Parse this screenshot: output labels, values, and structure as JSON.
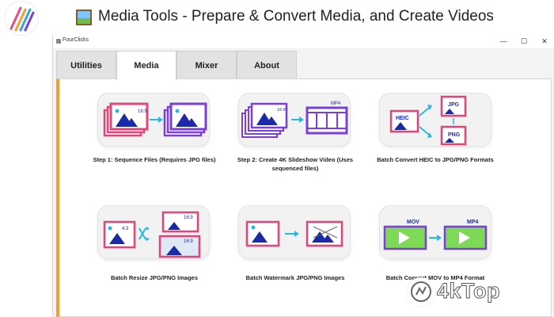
{
  "banner": {
    "title": "Media Tools - Prepare & Convert Media, and Create Videos"
  },
  "window": {
    "title": "FourClicks",
    "controls": [
      "—",
      "☐",
      "✕"
    ]
  },
  "tabs": [
    {
      "label": "Utilities",
      "active": false
    },
    {
      "label": "Media",
      "active": true
    },
    {
      "label": "Mixer",
      "active": false
    },
    {
      "label": "About",
      "active": false
    }
  ],
  "cards": [
    {
      "label": "Step 1: Sequence Files (Requires JPG files)",
      "icon": "sequence-files-icon"
    },
    {
      "label": "Step 2: Create 4K Slideshow Video (Uses sequenced files)",
      "icon": "slideshow-video-icon",
      "badge": "MP4"
    },
    {
      "label": "Batch Convert HEIC to JPG/PNG Formats",
      "icon": "heic-convert-icon",
      "badges": [
        "HEIC",
        "JPG",
        "PNG"
      ]
    },
    {
      "label": "Batch Resize JPG/PNG Images",
      "icon": "resize-icon",
      "badges": [
        "4:3",
        "16:9",
        "16:9"
      ]
    },
    {
      "label": "Batch Watermark JPG/PNG Images",
      "icon": "watermark-icon"
    },
    {
      "label": "Batch Convert MOV to MP4 Format",
      "icon": "mov-to-mp4-icon",
      "badges": [
        "MOV",
        "MP4"
      ]
    }
  ],
  "ratio_label": "16:9",
  "watermark": {
    "text": "4kTop"
  },
  "colors": {
    "accent": "#f0a030",
    "pink": "#e0457b",
    "purple": "#7a3fd6",
    "blue": "#1a2aa8",
    "cyan": "#2bb8d8",
    "green": "#7ed957"
  }
}
